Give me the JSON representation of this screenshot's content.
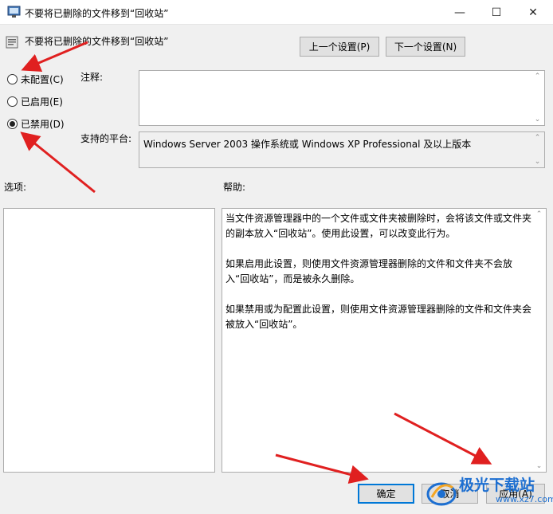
{
  "window": {
    "title": "不要将已删除的文件移到“回收站”",
    "minimize_glyph": "—",
    "maximize_glyph": "☐",
    "close_glyph": "✕"
  },
  "policy": {
    "name": "不要将已删除的文件移到“回收站”"
  },
  "nav": {
    "prev_label": "上一个设置(P)",
    "next_label": "下一个设置(N)"
  },
  "state_options": [
    {
      "label": "未配置(C)",
      "checked": false
    },
    {
      "label": "已启用(E)",
      "checked": false
    },
    {
      "label": "已禁用(D)",
      "checked": true
    }
  ],
  "comment": {
    "label": "注释:",
    "value": ""
  },
  "platform": {
    "label": "支持的平台:",
    "value": "Windows Server 2003 操作系统或 Windows XP Professional 及以上版本"
  },
  "options": {
    "label": "选项:"
  },
  "help": {
    "label": "帮助:",
    "paragraphs": [
      "当文件资源管理器中的一个文件或文件夹被删除时，会将该文件或文件夹的副本放入“回收站”。使用此设置，可以改变此行为。",
      "如果启用此设置，则使用文件资源管理器删除的文件和文件夹不会放入“回收站”，而是被永久删除。",
      "如果禁用或为配置此设置，则使用文件资源管理器删除的文件和文件夹会被放入“回收站”。"
    ]
  },
  "footer": {
    "ok_label": "确定",
    "cancel_label": "取消",
    "apply_label": "应用(A)"
  },
  "watermark": {
    "text": "极光下载站",
    "url": "www.xz7.com"
  },
  "colors": {
    "arrow": "#e02020",
    "accent": "#0078d7"
  },
  "icons": {
    "app": "policy-window-icon",
    "policy": "policy-setting-icon"
  }
}
